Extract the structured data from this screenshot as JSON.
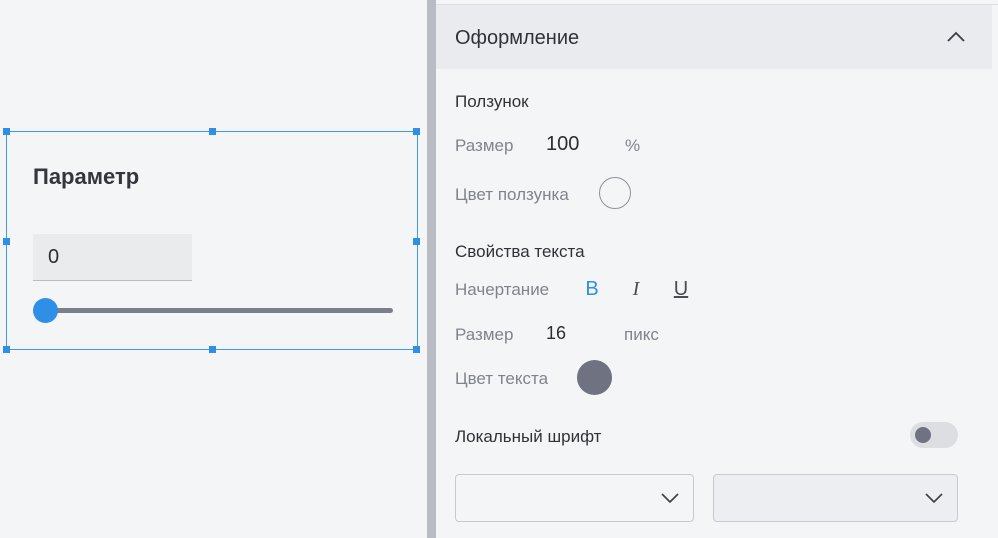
{
  "canvas": {
    "widget": {
      "title": "Параметр",
      "value": "0",
      "slider_value": 0
    }
  },
  "panel": {
    "section_title": "Оформление",
    "slider_group": {
      "heading": "Ползунок",
      "size_label": "Размер",
      "size_value": "100",
      "size_unit": "%",
      "color_label": "Цвет ползунка"
    },
    "text_group": {
      "heading": "Свойства текста",
      "style_label": "Начертание",
      "bold": "B",
      "italic": "I",
      "underline": "U",
      "size_label": "Размер",
      "size_value": "16",
      "size_unit": "пикс",
      "color_label": "Цвет текста",
      "color": "#6e7281"
    },
    "local_font": {
      "label": "Локальный шрифт",
      "enabled": false
    },
    "selects": [
      {
        "value": ""
      },
      {
        "value": ""
      }
    ]
  },
  "colors": {
    "accent": "#2f8fe6",
    "selection_border": "#3d9be9"
  }
}
